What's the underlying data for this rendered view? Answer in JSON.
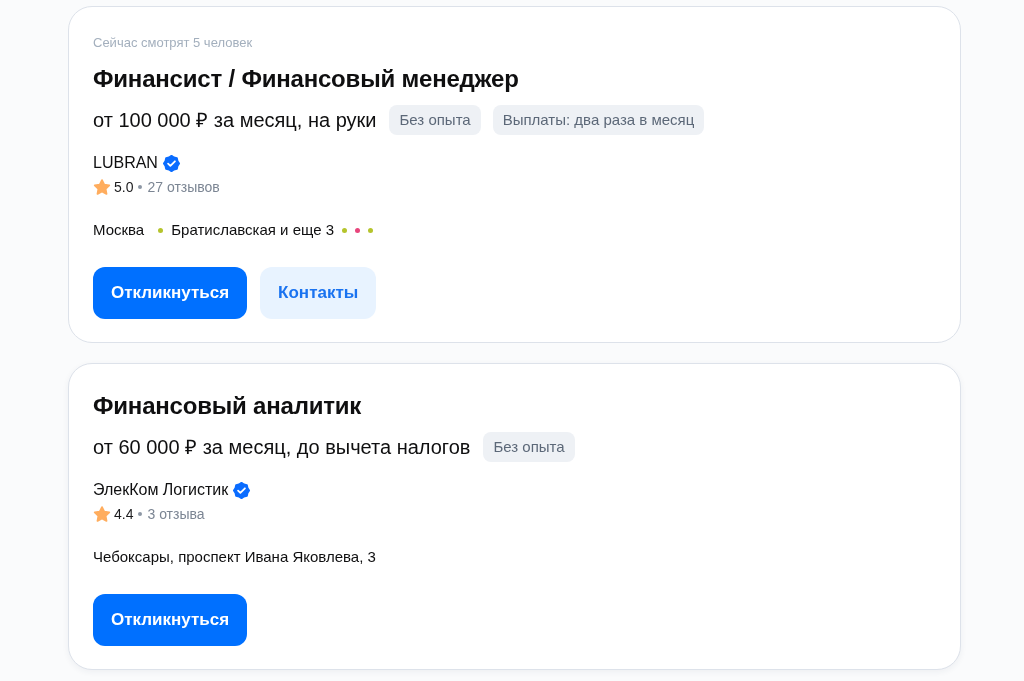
{
  "vacancies": [
    {
      "viewers": "Сейчас смотрят 5 человек",
      "title": "Финансист / Финансовый менеджер",
      "salary": "от 100 000 ₽ за месяц, на руки",
      "tags": [
        "Без опыта",
        "Выплаты: два раза в месяц"
      ],
      "company": "LUBRAN",
      "verified": true,
      "rating": "5.0",
      "reviews": "27 отзывов",
      "location": {
        "address": "Москва",
        "metro": [
          {
            "name": "Братиславская и еще 3",
            "color": "#b5c42c"
          }
        ],
        "more_lines": [
          {
            "color": "#b5c42c"
          },
          {
            "color": "#e8457c"
          },
          {
            "color": "#b5c42c"
          }
        ]
      },
      "buttons": [
        {
          "label": "Откликнуться",
          "kind": "primary"
        },
        {
          "label": "Контакты",
          "kind": "secondary"
        }
      ]
    },
    {
      "title": "Финансовый аналитик",
      "salary": "от 60 000 ₽ за месяц, до вычета налогов",
      "tags": [
        "Без опыта"
      ],
      "company": "ЭлекКом Логистик",
      "verified": true,
      "rating": "4.4",
      "reviews": "3 отзыва",
      "location": {
        "address": "Чебоксары, проспект Ивана Яковлева, 3"
      },
      "buttons": [
        {
          "label": "Откликнуться",
          "kind": "primary"
        }
      ]
    }
  ]
}
